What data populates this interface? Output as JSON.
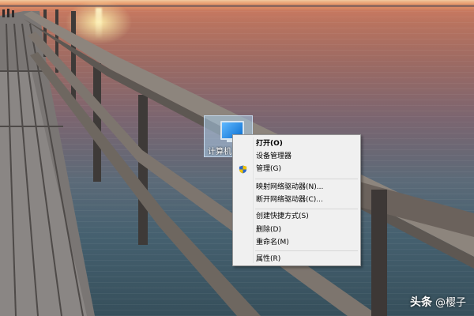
{
  "desktop": {
    "icon_label": "计算机"
  },
  "context_menu": {
    "items": [
      {
        "label": "打开(O)",
        "bold": true
      },
      {
        "label": "设备管理器"
      },
      {
        "label": "管理(G)",
        "icon": "shield-icon"
      },
      {
        "label": "映射网络驱动器(N)..."
      },
      {
        "label": "断开网络驱动器(C)..."
      },
      {
        "label": "创建快捷方式(S)"
      },
      {
        "label": "删除(D)"
      },
      {
        "label": "重命名(M)"
      },
      {
        "label": "属性(R)"
      }
    ]
  },
  "watermark": {
    "brand": "头条",
    "handle": "@樱子"
  },
  "colors": {
    "menu_bg": "#f0f0f0",
    "menu_border": "#979797",
    "selection_icon_bg": "#aacdeb"
  }
}
